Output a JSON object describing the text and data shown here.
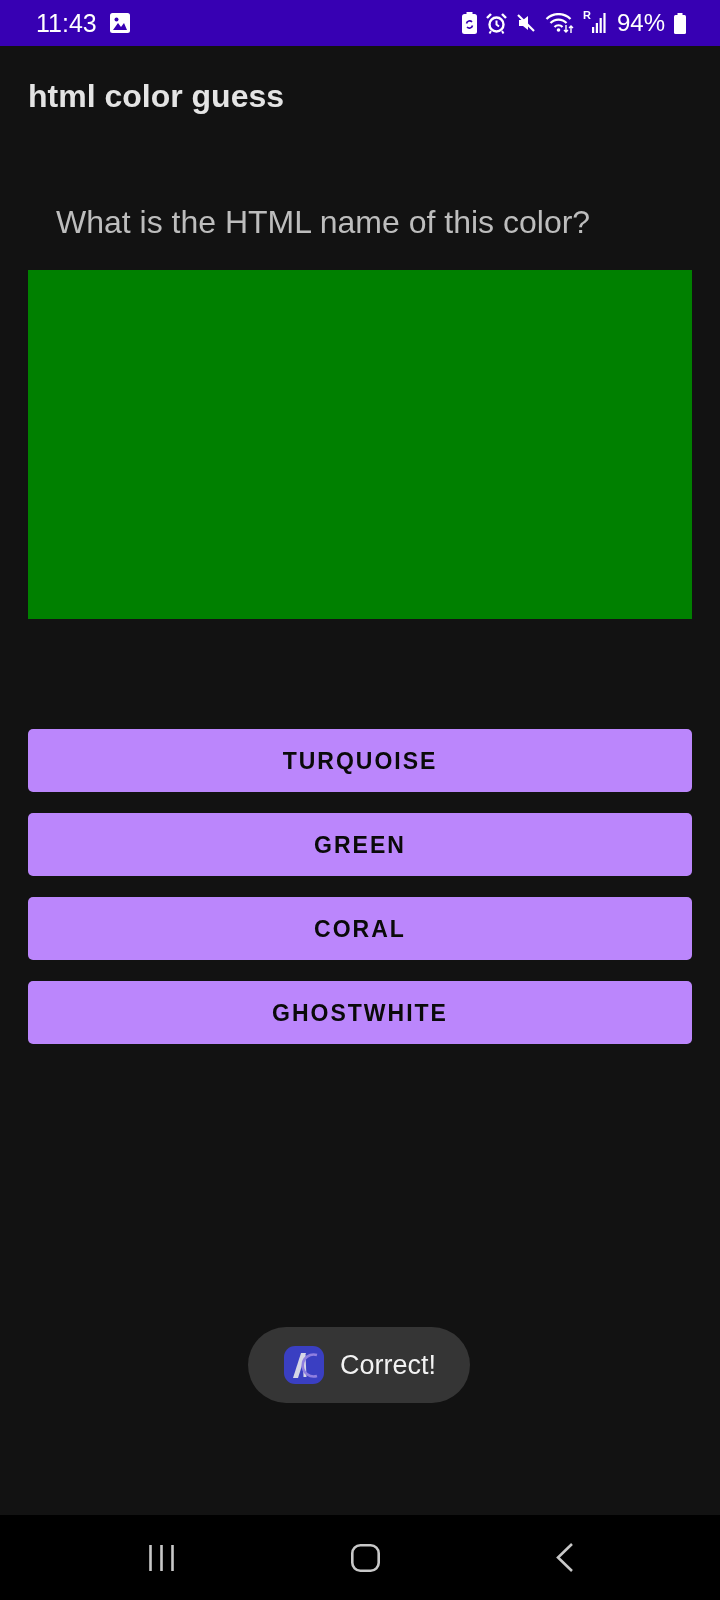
{
  "status_bar": {
    "time": "11:43",
    "signal_label": "R",
    "battery": "94%"
  },
  "app_bar": {
    "title": "html color guess"
  },
  "question": "What is the HTML name of this color?",
  "swatch": {
    "color": "#008000"
  },
  "answers": [
    "TURQUOISE",
    "GREEN",
    "CORAL",
    "GHOSTWHITE"
  ],
  "toast": {
    "message": "Correct!"
  }
}
